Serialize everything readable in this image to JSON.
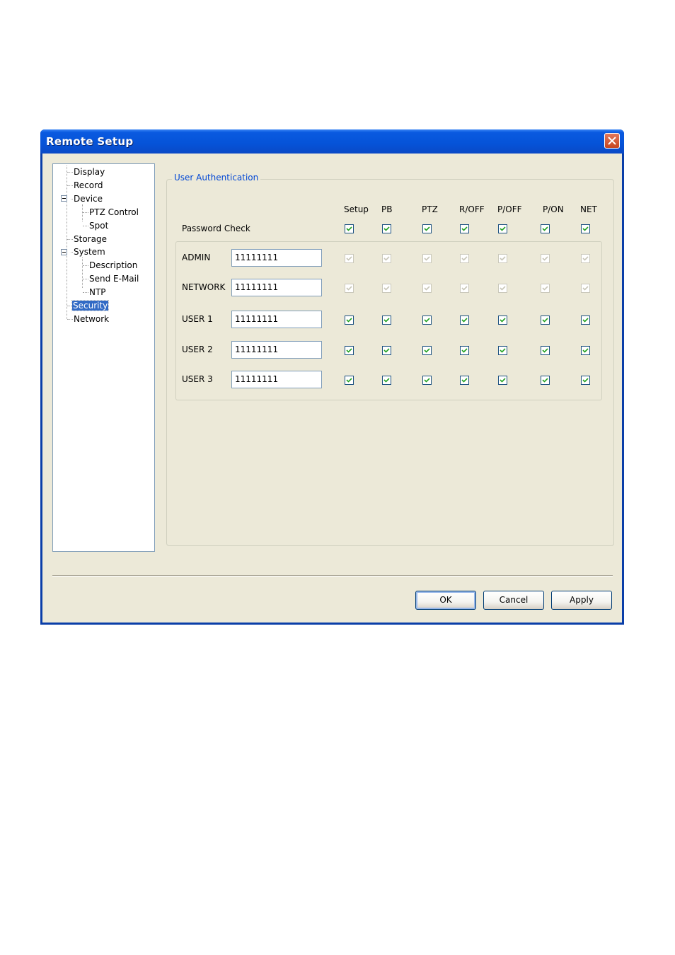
{
  "window": {
    "title": "Remote Setup"
  },
  "tree": {
    "items": [
      {
        "label": "Display"
      },
      {
        "label": "Record"
      },
      {
        "label": "Device"
      },
      {
        "label": "PTZ Control"
      },
      {
        "label": "Spot"
      },
      {
        "label": "Storage"
      },
      {
        "label": "System"
      },
      {
        "label": "Description"
      },
      {
        "label": "Send E-Mail"
      },
      {
        "label": "NTP"
      },
      {
        "label": "Security",
        "selected": true
      },
      {
        "label": "Network"
      }
    ]
  },
  "auth": {
    "group_title": "User Authentication",
    "columns": [
      "Setup",
      "PB",
      "PTZ",
      "R/OFF",
      "P/OFF",
      "P/ON",
      "NET"
    ],
    "password_check_label": "Password Check",
    "password_check": [
      true,
      true,
      true,
      true,
      true,
      true,
      true
    ],
    "users": [
      {
        "name": "ADMIN",
        "password": "11111111",
        "checks": [
          true,
          true,
          true,
          true,
          true,
          true,
          true
        ],
        "enabled": false
      },
      {
        "name": "NETWORK",
        "password": "11111111",
        "checks": [
          true,
          true,
          true,
          true,
          true,
          true,
          true
        ],
        "enabled": false
      },
      {
        "name": "USER 1",
        "password": "11111111",
        "checks": [
          true,
          true,
          true,
          true,
          true,
          true,
          true
        ],
        "enabled": true
      },
      {
        "name": "USER 2",
        "password": "11111111",
        "checks": [
          true,
          true,
          true,
          true,
          true,
          true,
          true
        ],
        "enabled": true
      },
      {
        "name": "USER 3",
        "password": "11111111",
        "checks": [
          true,
          true,
          true,
          true,
          true,
          true,
          true
        ],
        "enabled": true
      }
    ]
  },
  "buttons": {
    "ok": "OK",
    "cancel": "Cancel",
    "apply": "Apply"
  },
  "colors": {
    "titlebar": "#0553d8",
    "face": "#ece9d8",
    "selection": "#316ac5",
    "check": "#21a121"
  }
}
